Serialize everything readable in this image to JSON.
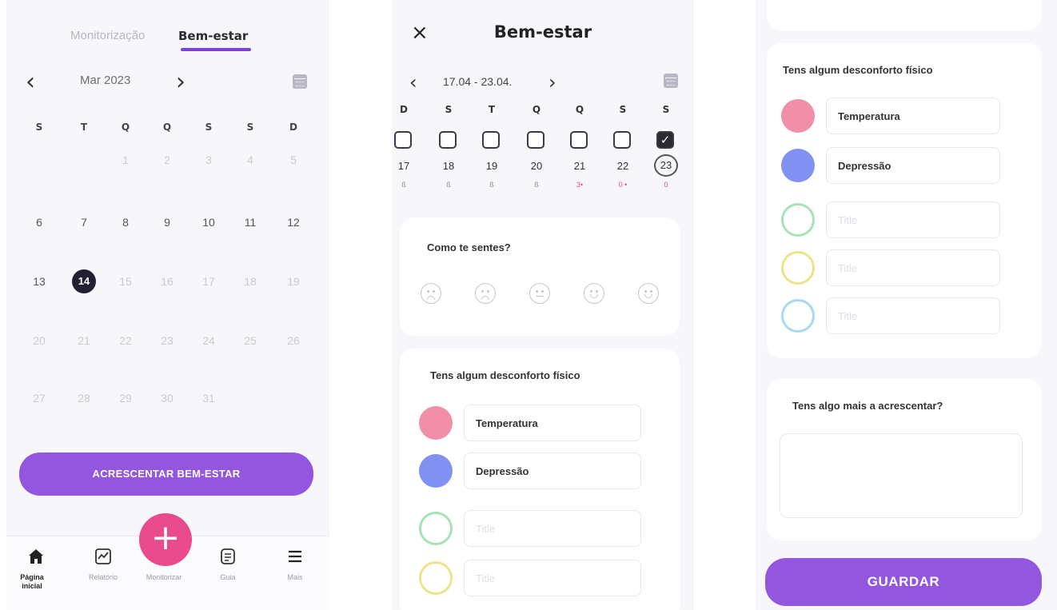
{
  "screen1": {
    "tabs": {
      "inactive": "Monitorização",
      "active": "Bem-estar"
    },
    "month_nav": {
      "prev": "‹",
      "next": "›",
      "label": "Mar 2023"
    },
    "weekdays": [
      "S",
      "T",
      "Q",
      "Q",
      "S",
      "S",
      "D"
    ],
    "weeks": [
      [
        "",
        "",
        "1",
        "2",
        "3",
        "4",
        "5"
      ],
      [
        "6",
        "7",
        "8",
        "9",
        "10",
        "11",
        "12"
      ],
      [
        "13",
        "14",
        "15",
        "16",
        "17",
        "18",
        "19"
      ],
      [
        "20",
        "21",
        "22",
        "23",
        "24",
        "25",
        "26"
      ],
      [
        "27",
        "28",
        "29",
        "30",
        "31",
        "",
        ""
      ]
    ],
    "today": "14",
    "add_button": "ACRESCENTAR BEM-ESTAR",
    "tabbar": [
      {
        "label": "Página inicial",
        "icon": "home-icon"
      },
      {
        "label": "Relatório",
        "icon": "chart-icon"
      },
      {
        "label": "Monitorizar",
        "icon": "plus-icon"
      },
      {
        "label": "Guia",
        "icon": "guide-icon"
      },
      {
        "label": "Mais",
        "icon": "menu-icon"
      }
    ],
    "fab": "+"
  },
  "screen2": {
    "close": "×",
    "title": "Bem-estar",
    "week_prev": "‹",
    "week_range": "17.04 - 23.04.",
    "week_next": "›",
    "weekdays": [
      "D",
      "S",
      "T",
      "Q",
      "Q",
      "S",
      "S"
    ],
    "days": [
      "17",
      "18",
      "19",
      "20",
      "21",
      "22",
      "23"
    ],
    "checked": [
      "false",
      "false",
      "false",
      "false",
      "false",
      "false",
      "true"
    ],
    "check_glyph": "✓",
    "marks": [
      "ß",
      "ß",
      "ß",
      "ß",
      "3•",
      "0 •",
      "0"
    ],
    "mood_card": {
      "title": "Como te sentes?"
    },
    "symptoms_card": {
      "title": "Tens algum desconforto físico",
      "items": [
        {
          "label": "Temperatura",
          "color": "#f08fa7"
        },
        {
          "label": "Depressão",
          "color": "#8191f2"
        }
      ],
      "empty": [
        {
          "placeholder": "Title",
          "color": "#a8e2b5"
        },
        {
          "placeholder": "Title",
          "color": "#ece489"
        }
      ]
    }
  },
  "screen3": {
    "symptoms_card": {
      "title": "Tens algum desconforto físico",
      "items": [
        {
          "label": "Temperatura",
          "color": "#f08fa7"
        },
        {
          "label": "Depressão",
          "color": "#8191f2"
        }
      ],
      "empty": [
        {
          "placeholder": "Title",
          "color": "#a8e2b5"
        },
        {
          "placeholder": "Title",
          "color": "#ece489"
        },
        {
          "placeholder": "Title",
          "color": "#a9d9f2"
        }
      ]
    },
    "notes_card": {
      "title": "Tens algo mais a acrescentar?",
      "value": ""
    },
    "save_button": "GUARDAR"
  },
  "colors": {
    "accent": "#9356df",
    "fab": "#e94a8c",
    "tab_underline": "#7b42d6"
  }
}
